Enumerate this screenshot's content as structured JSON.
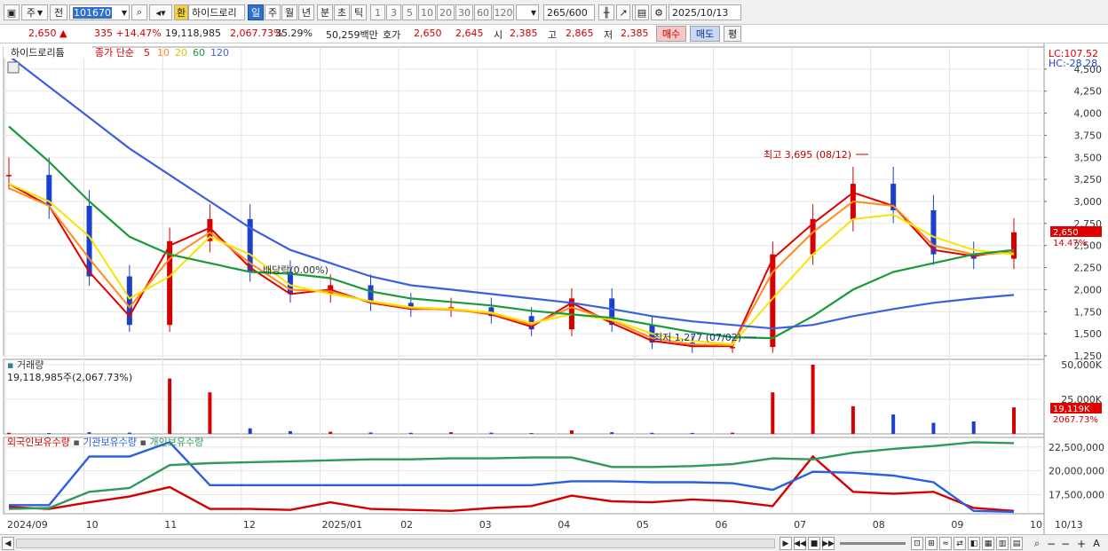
{
  "toolbar": {
    "market_label": "주",
    "prev_label": "전",
    "stock_code": "101670",
    "stock_name": "하이드로리",
    "halt_badge": "환",
    "period_tabs": [
      "일",
      "주",
      "월",
      "년",
      "분",
      "초",
      "틱"
    ],
    "minute_options": [
      "1",
      "3",
      "5",
      "10",
      "20",
      "30",
      "60",
      "120"
    ],
    "count_value": "265",
    "count_total": "/600",
    "date_value": "2025/10/13"
  },
  "infobar": {
    "price": "2,650",
    "change": "335",
    "change_pct": "+14.47%",
    "volume": "19,118,985",
    "volume_pct": "2,067.73%",
    "turnover_pct": "35.29%",
    "amount": "50,259백만",
    "quote_label": "호가",
    "ask": "2,650",
    "bid": "2,645",
    "open_label": "시",
    "open": "2,385",
    "high_label": "고",
    "high": "2,865",
    "low_label": "저",
    "low": "2,385",
    "buy_label": "매수",
    "sell_label": "매도",
    "eval_label": "평"
  },
  "price_panel": {
    "title": "하이드로리튬",
    "ma_label": "종가 단순",
    "ma_periods": [
      "5",
      "10",
      "20",
      "60",
      "120"
    ],
    "lc_label": "LC:107.52",
    "hc_label": "HC:-28.28",
    "current_price_tag": "2,650",
    "current_change_tag": "14.47%",
    "high_annotation": "최고 3,695 (08/12)",
    "low_annotation": "최저 1,277 (07/02)",
    "dividend_annotation": "배당락(0.00%)"
  },
  "volume_panel": {
    "title": "거래량",
    "subtitle": "19,118,985주(2,067.73%)",
    "current_tag": "19,119K",
    "current_pct_tag": "2067.73%"
  },
  "holding_panel": {
    "legend": [
      "외국인보유수량",
      "기관보유수량",
      "개인보유수량"
    ]
  },
  "x_axis": {
    "labels": [
      "2024/09",
      "10",
      "11",
      "12",
      "2025/01",
      "02",
      "03",
      "04",
      "05",
      "06",
      "07",
      "08",
      "09",
      "10",
      "10/13"
    ]
  },
  "colors": {
    "up": "#d40000",
    "down": "#1c3fcc",
    "ma5": "#e00000",
    "ma10": "#ff8c1a",
    "ma20": "#f5e600",
    "ma60": "#1a9a3a",
    "ma120": "#3b5fe0",
    "foreign": "#d40000",
    "institution": "#2a5fe0",
    "individual": "#2e9a5a"
  },
  "chart_data": [
    {
      "type": "line",
      "name": "price",
      "x": [
        "2024/09",
        "10",
        "11",
        "12",
        "2025/01",
        "02",
        "03",
        "04",
        "05",
        "06",
        "07",
        "08",
        "09",
        "10"
      ],
      "ylim": [
        1250,
        4750
      ],
      "yticks": [
        1250,
        1500,
        1750,
        2000,
        2250,
        2500,
        2750,
        3000,
        3250,
        3500,
        3750,
        4000,
        4250,
        4500
      ],
      "ytick_labels": [
        "1,250",
        "1,500",
        "1,750",
        "2,000",
        "2,250",
        "2,500",
        "2,750",
        "3,000",
        "3,250",
        "3,500",
        "3,750",
        "4,000",
        "4,250",
        "4,500"
      ],
      "close": [
        3300,
        2950,
        2150,
        1600,
        2550,
        2800,
        2200,
        1950,
        2050,
        1850,
        1780,
        1800,
        1700,
        1550,
        1900,
        1600,
        1400,
        1350,
        1350,
        2400,
        2800,
        3200,
        2900,
        2400,
        2350,
        2650
      ],
      "series": [
        {
          "name": "5",
          "values": [
            3200,
            2950,
            2200,
            1700,
            2500,
            2700,
            2250,
            1950,
            2000,
            1850,
            1780,
            1780,
            1720,
            1580,
            1850,
            1620,
            1420,
            1360,
            1360,
            2350,
            2750,
            3100,
            2950,
            2450,
            2380,
            2450
          ]
        },
        {
          "name": "10",
          "values": [
            3150,
            2950,
            2350,
            1800,
            2350,
            2650,
            2300,
            2000,
            1980,
            1860,
            1790,
            1770,
            1730,
            1600,
            1800,
            1650,
            1450,
            1380,
            1370,
            2200,
            2650,
            3000,
            2950,
            2500,
            2400,
            2420
          ]
        },
        {
          "name": "20",
          "values": [
            3200,
            3000,
            2600,
            1900,
            2150,
            2600,
            2400,
            2050,
            1950,
            1870,
            1800,
            1780,
            1740,
            1620,
            1720,
            1660,
            1500,
            1420,
            1380,
            1900,
            2400,
            2800,
            2850,
            2600,
            2450,
            2400
          ]
        },
        {
          "name": "60",
          "values": [
            3850,
            3450,
            3000,
            2600,
            2400,
            2300,
            2200,
            2180,
            2130,
            1980,
            1900,
            1860,
            1820,
            1760,
            1720,
            1680,
            1600,
            1520,
            1460,
            1450,
            1700,
            2000,
            2200,
            2300,
            2400,
            2450
          ]
        },
        {
          "name": "120",
          "values": [
            4650,
            4300,
            3950,
            3600,
            3300,
            3000,
            2700,
            2450,
            2300,
            2150,
            2050,
            2000,
            1950,
            1900,
            1850,
            1780,
            1700,
            1640,
            1600,
            1560,
            1600,
            1700,
            1780,
            1850,
            1900,
            1940
          ]
        }
      ]
    },
    {
      "type": "bar",
      "name": "volume",
      "ylim": [
        0,
        50000
      ],
      "yticks": [
        25000,
        50000
      ],
      "ytick_labels": [
        "25,000K",
        "50,000K"
      ],
      "values": [
        800,
        600,
        1200,
        900,
        40000,
        30000,
        4000,
        2000,
        1500,
        1000,
        800,
        1200,
        900,
        600,
        2500,
        1200,
        800,
        700,
        900,
        30000,
        50000,
        20000,
        14000,
        8000,
        9000,
        19119
      ]
    },
    {
      "type": "line",
      "name": "holdings",
      "ylim": [
        15500000,
        23500000
      ],
      "yticks": [
        17500000,
        20000000,
        22500000
      ],
      "ytick_labels": [
        "17,500,000",
        "20,000,000",
        "22,500,000"
      ],
      "series": [
        {
          "name": "외국인보유수량",
          "values": [
            16200000,
            16000000,
            16700000,
            17300000,
            18300000,
            16000000,
            16000000,
            15900000,
            16700000,
            16000000,
            15900000,
            15800000,
            16100000,
            16300000,
            17400000,
            16800000,
            16700000,
            17000000,
            16800000,
            16300000,
            21500000,
            17800000,
            17600000,
            17800000,
            16100000,
            15800000
          ]
        },
        {
          "name": "기관보유수량",
          "values": [
            16400000,
            16400000,
            21500000,
            21500000,
            23000000,
            18500000,
            18500000,
            18500000,
            18500000,
            18500000,
            18500000,
            18500000,
            18500000,
            18500000,
            18900000,
            18900000,
            18800000,
            18800000,
            18700000,
            18000000,
            19900000,
            19800000,
            19500000,
            18800000,
            15800000,
            15700000
          ]
        },
        {
          "name": "개인보유수량",
          "values": [
            16000000,
            16100000,
            17800000,
            18200000,
            20600000,
            20800000,
            20900000,
            21000000,
            21100000,
            21200000,
            21200000,
            21300000,
            21300000,
            21400000,
            21400000,
            20400000,
            20400000,
            20500000,
            20700000,
            21300000,
            21200000,
            21900000,
            22300000,
            22600000,
            23000000,
            22900000
          ]
        }
      ]
    }
  ]
}
